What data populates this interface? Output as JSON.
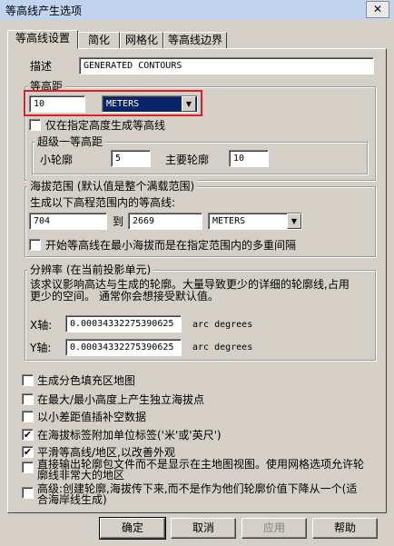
{
  "window": {
    "title": "等高线产生选项",
    "close_glyph": "✕"
  },
  "tabs": [
    {
      "label": "等高线设置"
    },
    {
      "label": "简化"
    },
    {
      "label": "网格化"
    },
    {
      "label": "等高线边界"
    }
  ],
  "description": {
    "label": "描述",
    "value": "GENERATED CONTOURS"
  },
  "interval": {
    "legend": "等高距",
    "value": "10",
    "unit": "METERS",
    "only_specified_label": "仅在指定高度生成等高线",
    "only_specified_checked": false,
    "sub": {
      "legend": "超级一等高距",
      "minor_label": "小轮廓",
      "minor_value": "5",
      "major_label": "主要轮廓",
      "major_value": "10"
    }
  },
  "elevation": {
    "legend": "海拔范围 (默认值是整个满载范围)",
    "prompt": "生成以下高程范围内的等高线:",
    "from": "704",
    "to_label": "到",
    "to": "2669",
    "unit": "METERS",
    "multiple_label": "开始等高线在最小海拔而是在指定范围内的多重间隔",
    "multiple_checked": false
  },
  "resolution": {
    "legend": "分辨率 (在当前投影单元)",
    "desc_line1": "该求议影响高达与生成的轮廓。大量导致更少的详细的轮廓线,占用",
    "desc_line2": "更少的空间。 通常你会想接受默认值。",
    "x_label": "X轴:",
    "x_value": "0.00034332275390625",
    "x_unit": "arc degrees",
    "y_label": "Y轴:",
    "y_value": "0.00034332275390625",
    "y_unit": "arc degrees"
  },
  "options": [
    {
      "label": "生成分色填充区地图",
      "checked": false
    },
    {
      "label": "在最大/最小高度上产生独立海拔点",
      "checked": false
    },
    {
      "label": "以小差距值插补空数据",
      "checked": false
    },
    {
      "label": "在海拔标签附加单位标签('米'或'英尺')",
      "checked": true
    },
    {
      "label": "平滑等高线/地区,以改善外观",
      "checked": true
    },
    {
      "label": "直接输出轮廓包文件而不是显示在主地图视图。使用网格选项允许轮",
      "label2": "廓线非常大的地区",
      "checked": false
    },
    {
      "label": "高级:创建轮廓,海拔传下来,而不是作为他们轮廓价值下降从一个(适",
      "label2": "合海岸线生成)",
      "checked": false
    }
  ],
  "buttons": {
    "ok": "确定",
    "cancel": "取消",
    "apply": "应用",
    "help": "帮助"
  },
  "combo_arrow": "▼",
  "check_glyph": "✔"
}
